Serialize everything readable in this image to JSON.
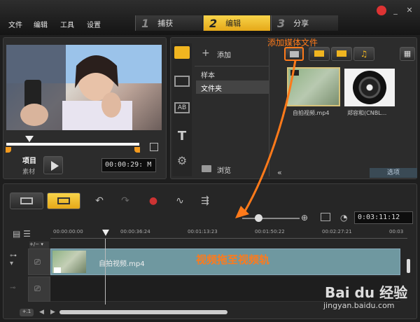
{
  "menu": [
    "文件",
    "编辑",
    "工具",
    "设置"
  ],
  "steps": [
    {
      "num": "1",
      "label": "捕获"
    },
    {
      "num": "2",
      "label": "编辑"
    },
    {
      "num": "3",
      "label": "分享"
    }
  ],
  "player": {
    "project_label": "项目",
    "clip_label": "素材",
    "timecode": "00:00:29: M"
  },
  "library": {
    "add_label": "添加",
    "folders": [
      "样本",
      "文件夹"
    ],
    "browse_label": "浏览",
    "options_label": "选项",
    "thumbs": [
      {
        "label": "自拍视频.mp4"
      },
      {
        "label": "郑容和(CNBL..."
      }
    ]
  },
  "annotations": {
    "add_media": "添加媒体文件",
    "drag_to_track": "视频拖至视频轨"
  },
  "timeline": {
    "total_time": "0:03:11:12",
    "ruler": [
      "00:00:00:00",
      "00:00:36:24",
      "00:01:13:23",
      "00:01:50:22",
      "00:02:27:21",
      "00:03"
    ],
    "clip_label": "自拍视频.mp4"
  },
  "watermark": {
    "brand": "Bai du 经验",
    "url": "jingyan.baidu.com"
  },
  "colors": {
    "accent": "#f0b520",
    "annotation": "#ff7a1a",
    "track": "#6f98a0"
  }
}
